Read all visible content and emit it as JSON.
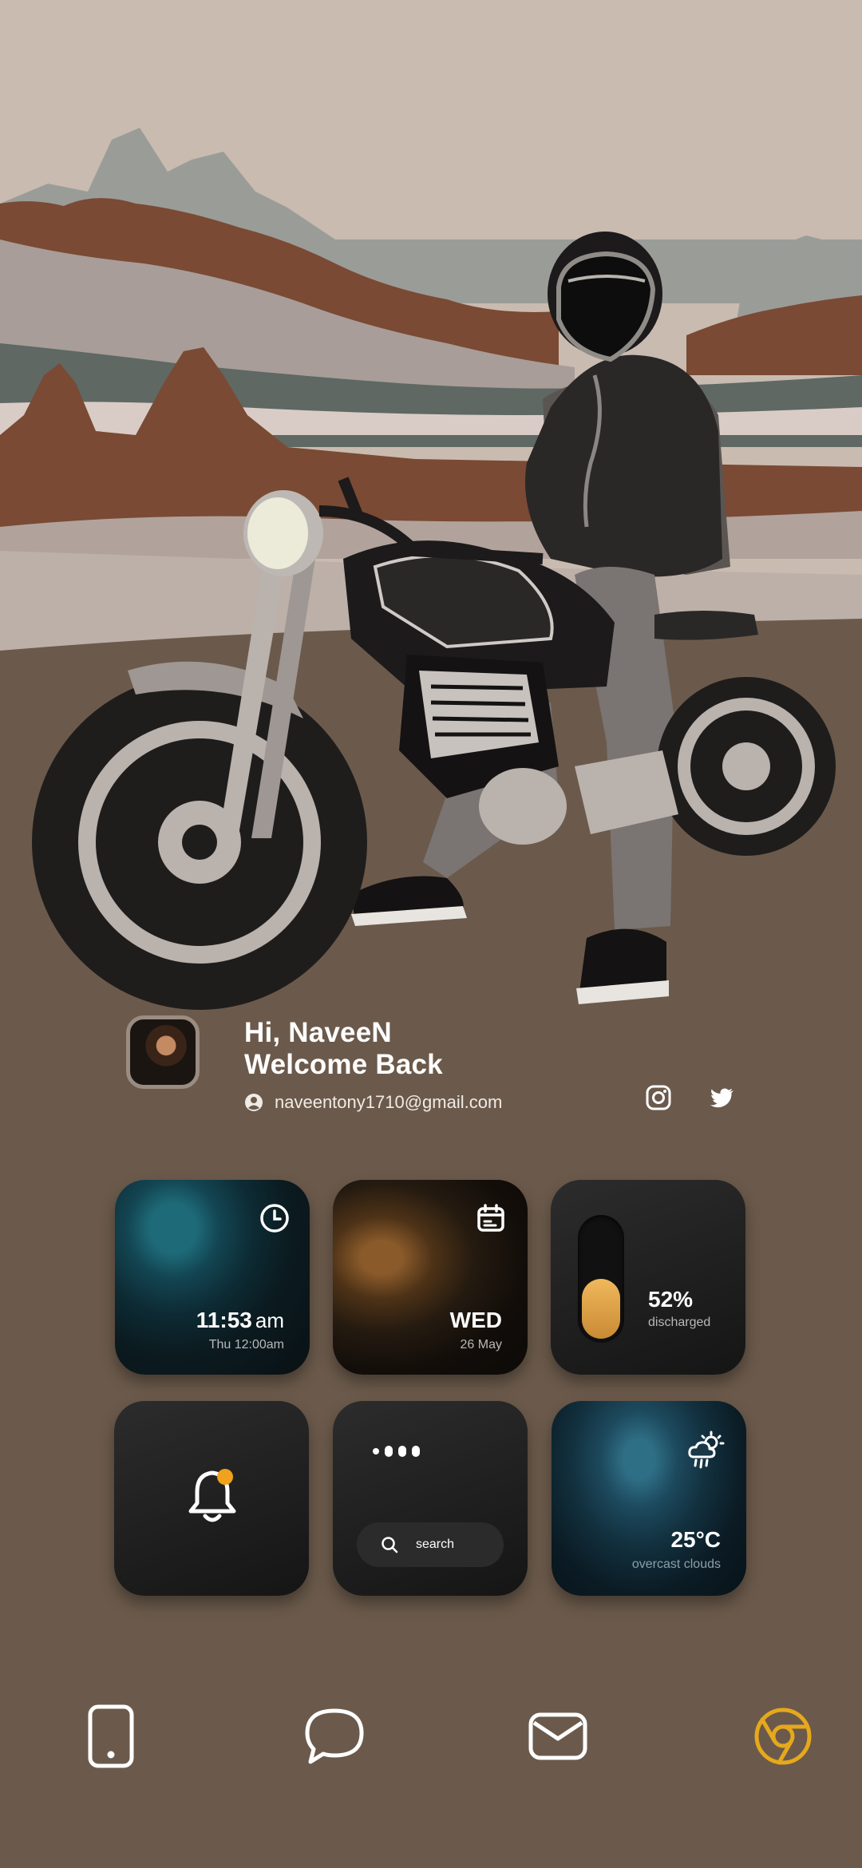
{
  "profile": {
    "greeting": "Hi, NaveeN",
    "welcome": "Welcome Back",
    "email": "naveentony1710@gmail.com"
  },
  "widgets": {
    "clock": {
      "time": "11:53",
      "ampm": "am",
      "alarm": "Thu 12:00am",
      "icon": "clock-icon"
    },
    "date": {
      "day": "WED",
      "date": "26 May",
      "icon": "calendar-icon"
    },
    "battery": {
      "percent_label": "52%",
      "status": "discharged",
      "level": 0.52,
      "fill_color": "#e6a94c"
    },
    "notification": {
      "icon": "bell-icon",
      "badge_color": "#f0a21c"
    },
    "search": {
      "label": "search",
      "icon": "search-icon"
    },
    "weather": {
      "temperature": "25°C",
      "condition": "overcast clouds",
      "icon": "cloud-sun-rain-icon"
    }
  },
  "dock": {
    "items": [
      {
        "name": "phone",
        "icon": "phone-icon"
      },
      {
        "name": "messages",
        "icon": "chat-bubble-icon"
      },
      {
        "name": "mail",
        "icon": "mail-icon"
      },
      {
        "name": "chrome",
        "icon": "chrome-icon",
        "color": "#e6a81c"
      }
    ]
  },
  "colors": {
    "background": "#6b5a4b",
    "sky": "#c9bbb0",
    "accent": "#e6a81c"
  }
}
